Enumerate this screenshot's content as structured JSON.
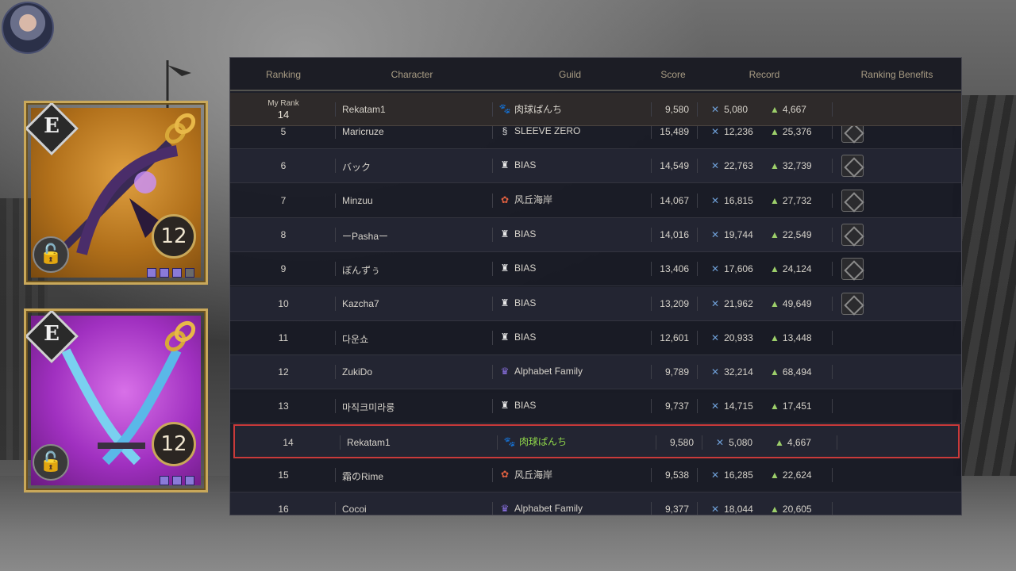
{
  "headers": {
    "ranking": "Ranking",
    "character": "Character",
    "guild": "Guild",
    "score": "Score",
    "record": "Record",
    "benefits": "Ranking Benefits"
  },
  "my_rank": {
    "label": "My Rank",
    "rank": "14",
    "character": "Rekatam1",
    "guild": "肉球ぱんち",
    "score": "9,580",
    "kills": "5,080",
    "assists": "4,667"
  },
  "rows": [
    {
      "rank": "5",
      "character": "Maricruze",
      "guild": "SLEEVE ZERO",
      "score": "15,489",
      "kills": "12,236",
      "assists": "25,376",
      "benefit": true
    },
    {
      "rank": "6",
      "character": "バック",
      "guild": "BIAS",
      "score": "14,549",
      "kills": "22,763",
      "assists": "32,739",
      "benefit": true
    },
    {
      "rank": "7",
      "character": "Minzuu",
      "guild": "风丘海岸",
      "score": "14,067",
      "kills": "16,815",
      "assists": "27,732",
      "benefit": true
    },
    {
      "rank": "8",
      "character": "ーPashaー",
      "guild": "BIAS",
      "score": "14,016",
      "kills": "19,744",
      "assists": "22,549",
      "benefit": true
    },
    {
      "rank": "9",
      "character": "ぼんずぅ",
      "guild": "BIAS",
      "score": "13,406",
      "kills": "17,606",
      "assists": "24,124",
      "benefit": true
    },
    {
      "rank": "10",
      "character": "Kazcha7",
      "guild": "BIAS",
      "score": "13,209",
      "kills": "21,962",
      "assists": "49,649",
      "benefit": true
    },
    {
      "rank": "11",
      "character": "다운쇼",
      "guild": "BIAS",
      "score": "12,601",
      "kills": "20,933",
      "assists": "13,448",
      "benefit": false
    },
    {
      "rank": "12",
      "character": "ZukiDo",
      "guild": "Alphabet Family",
      "score": "9,789",
      "kills": "32,214",
      "assists": "68,494",
      "benefit": false
    },
    {
      "rank": "13",
      "character": "마직크미라룽",
      "guild": "BIAS",
      "score": "9,737",
      "kills": "14,715",
      "assists": "17,451",
      "benefit": false
    },
    {
      "rank": "14",
      "character": "Rekatam1",
      "guild": "肉球ぱんち",
      "score": "9,580",
      "kills": "5,080",
      "assists": "4,667",
      "benefit": false,
      "highlight": true
    },
    {
      "rank": "15",
      "character": "霜のRime",
      "guild": "风丘海岸",
      "score": "9,538",
      "kills": "16,285",
      "assists": "22,624",
      "benefit": false
    },
    {
      "rank": "16",
      "character": "Cocoi",
      "guild": "Alphabet Family",
      "score": "9,377",
      "kills": "18,044",
      "assists": "20,605",
      "benefit": false
    }
  ],
  "cards": [
    {
      "grade": "E",
      "level": "12",
      "icon": "bow-weapon-icon"
    },
    {
      "grade": "E",
      "level": "12",
      "icon": "dual-blades-weapon-icon"
    }
  ],
  "colors": {
    "highlight_border": "#c93a3a",
    "my_guild_green": "#8fd64a",
    "header_text": "#a89c84"
  }
}
